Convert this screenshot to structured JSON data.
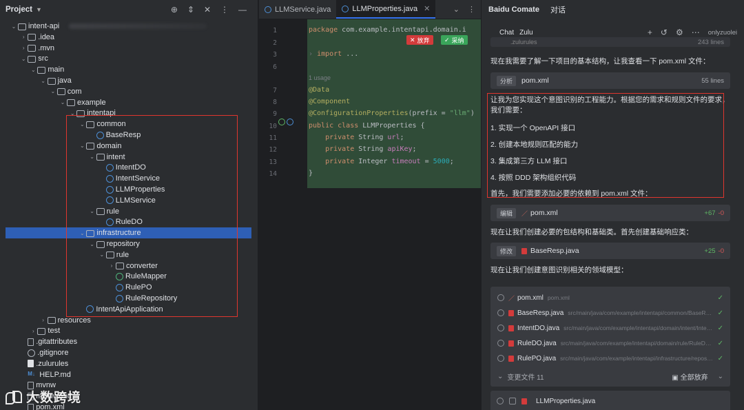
{
  "project": {
    "title": "Project",
    "tree": [
      {
        "label": "intent-api",
        "indent": 0,
        "arrow": "down",
        "icon": "folder"
      },
      {
        "label": ".idea",
        "indent": 1,
        "arrow": "right",
        "icon": "folder"
      },
      {
        "label": ".mvn",
        "indent": 1,
        "arrow": "right",
        "icon": "folder"
      },
      {
        "label": "src",
        "indent": 1,
        "arrow": "down",
        "icon": "folder"
      },
      {
        "label": "main",
        "indent": 2,
        "arrow": "down",
        "icon": "folder"
      },
      {
        "label": "java",
        "indent": 3,
        "arrow": "down",
        "icon": "folder"
      },
      {
        "label": "com",
        "indent": 4,
        "arrow": "down",
        "icon": "folder"
      },
      {
        "label": "example",
        "indent": 5,
        "arrow": "down",
        "icon": "folder"
      },
      {
        "label": "intentapi",
        "indent": 6,
        "arrow": "down",
        "icon": "folder"
      },
      {
        "label": "common",
        "indent": 7,
        "arrow": "down",
        "icon": "folder"
      },
      {
        "label": "BaseResp",
        "indent": 8,
        "arrow": "",
        "icon": "class"
      },
      {
        "label": "domain",
        "indent": 7,
        "arrow": "down",
        "icon": "folder"
      },
      {
        "label": "intent",
        "indent": 8,
        "arrow": "down",
        "icon": "folder"
      },
      {
        "label": "IntentDO",
        "indent": 9,
        "arrow": "",
        "icon": "class"
      },
      {
        "label": "IntentService",
        "indent": 9,
        "arrow": "",
        "icon": "class"
      },
      {
        "label": "LLMProperties",
        "indent": 9,
        "arrow": "",
        "icon": "class"
      },
      {
        "label": "LLMService",
        "indent": 9,
        "arrow": "",
        "icon": "class"
      },
      {
        "label": "rule",
        "indent": 8,
        "arrow": "down",
        "icon": "folder"
      },
      {
        "label": "RuleDO",
        "indent": 9,
        "arrow": "",
        "icon": "class"
      },
      {
        "label": "infrastructure",
        "indent": 7,
        "arrow": "down",
        "icon": "folder",
        "selected": true
      },
      {
        "label": "repository",
        "indent": 8,
        "arrow": "down",
        "icon": "folder"
      },
      {
        "label": "rule",
        "indent": 9,
        "arrow": "down",
        "icon": "folder"
      },
      {
        "label": "converter",
        "indent": 10,
        "arrow": "right",
        "icon": "folder"
      },
      {
        "label": "RuleMapper",
        "indent": 10,
        "arrow": "",
        "icon": "interface"
      },
      {
        "label": "RulePO",
        "indent": 10,
        "arrow": "",
        "icon": "class"
      },
      {
        "label": "RuleRepository",
        "indent": 10,
        "arrow": "",
        "icon": "class"
      },
      {
        "label": "IntentApiApplication",
        "indent": 7,
        "arrow": "",
        "icon": "class"
      },
      {
        "label": "resources",
        "indent": 3,
        "arrow": "right",
        "icon": "folder"
      },
      {
        "label": "test",
        "indent": 2,
        "arrow": "right",
        "icon": "folder"
      },
      {
        "label": ".gitattributes",
        "indent": 1,
        "arrow": "",
        "icon": "file"
      },
      {
        "label": ".gitignore",
        "indent": 1,
        "arrow": "",
        "icon": "circle"
      },
      {
        "label": ".zulurules",
        "indent": 1,
        "arrow": "",
        "icon": "filew"
      },
      {
        "label": "HELP.md",
        "indent": 1,
        "arrow": "",
        "icon": "md"
      },
      {
        "label": "mvnw",
        "indent": 1,
        "arrow": "",
        "icon": "file"
      },
      {
        "label": "mvnw.cmd",
        "indent": 1,
        "arrow": "",
        "icon": "file"
      },
      {
        "label": "pom.xml",
        "indent": 1,
        "arrow": "",
        "icon": "file"
      }
    ]
  },
  "editor": {
    "tabs": [
      {
        "label": "LLMService.java",
        "active": false
      },
      {
        "label": "LLMProperties.java",
        "active": true
      }
    ],
    "reject_label": "放弃",
    "accept_label": "采纳",
    "lines": [
      {
        "n": "1",
        "html": "<span class='kw'>package</span> com.example.intentapi.domain.i"
      },
      {
        "n": "2",
        "html": ""
      },
      {
        "n": "3",
        "html": "<span class='foldmark'>›</span> <span class='kw'>import</span> ..."
      },
      {
        "n": "6",
        "html": ""
      },
      {
        "n": "",
        "html": "<span class='cm'>1 usage</span>"
      },
      {
        "n": "7",
        "html": "<span class='an'>@Data</span>"
      },
      {
        "n": "8",
        "html": "<span class='an'>@Component</span>"
      },
      {
        "n": "9",
        "html": "<span class='an'>@ConfigurationProperties</span>(prefix = <span class='str'>\"llm\"</span>)"
      },
      {
        "n": "10",
        "html": "<span class='kw'>public class</span> LLMProperties {"
      },
      {
        "n": "11",
        "html": "    <span class='kw'>private</span> String <span class='fld'>url</span>;"
      },
      {
        "n": "12",
        "html": "    <span class='kw'>private</span> String <span class='fld'>apiKey</span>;"
      },
      {
        "n": "13",
        "html": "    <span class='kw'>private</span> Integer <span class='fld'>timeout</span> = <span class='num'>5000</span>;"
      },
      {
        "n": "14",
        "html": "}"
      }
    ]
  },
  "assistant": {
    "brand": "Baidu Comate",
    "tab": "对话",
    "chat_label": "Chat",
    "zulu_label": "Zulu",
    "user": "onlyzuolei",
    "top_card_text": ".zulurules",
    "top_card_right": "243 lines",
    "msg1": "现在我需要了解一下项目的基本结构，让我查看一下 pom.xml 文件：",
    "card_analyze": {
      "tag": "分析",
      "file": "pom.xml",
      "right": "55 lines"
    },
    "intro": "让我为您实现这个意图识别的工程能力。根据您的需求和规则文件的要求，我们需要：",
    "steps": [
      "1. 实现一个 OpenAPI 接口",
      "2. 创建本地规则匹配的能力",
      "3. 集成第三方 LLM 接口",
      "4. 按照 DDD 架构组织代码"
    ],
    "msg2": "首先，我们需要添加必要的依赖到 pom.xml 文件：",
    "card_edit": {
      "tag": "编辑",
      "file": "pom.xml",
      "plus": "+67",
      "minus": "-0"
    },
    "msg3": "现在让我们创建必要的包结构和基础类。首先创建基础响应类：",
    "card_modify": {
      "tag": "修改",
      "file": "BaseResp.java",
      "plus": "+25",
      "minus": "-0"
    },
    "msg4": "现在让我们创建意图识别相关的领域模型：",
    "files": [
      {
        "name": "pom.xml",
        "path": "pom.xml",
        "type": "xml"
      },
      {
        "name": "BaseResp.java",
        "path": "src/main/java/com/example/intentapi/common/BaseResp.java",
        "type": "java"
      },
      {
        "name": "IntentDO.java",
        "path": "src/main/java/com/example/intentapi/domain/intent/IntentDO.java",
        "type": "java"
      },
      {
        "name": "RuleDO.java",
        "path": "src/main/java/com/example/intentapi/domain/rule/RuleDO.java",
        "type": "java"
      },
      {
        "name": "RulePO.java",
        "path": "src/main/java/com/example/intentapi/infrastructure/repository/rule/RulePO.java",
        "type": "java"
      }
    ],
    "changed_files": "变更文件 11",
    "discard_all": "全部放弃",
    "bottom_file": "LLMProperties.java"
  },
  "watermark": "大数跨境",
  "colors": {
    "accent": "#3574f0",
    "highlight_box": "#e0362e",
    "diff_bg": "#304c38"
  }
}
